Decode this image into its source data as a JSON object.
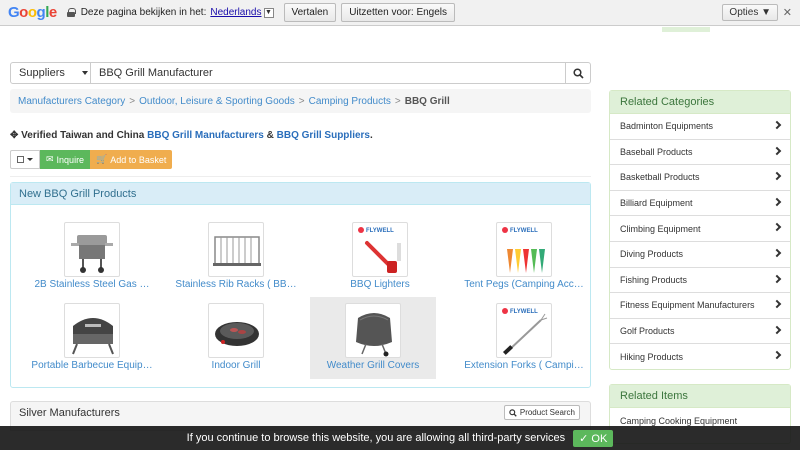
{
  "translate_bar": {
    "message": "Deze pagina bekijken in het:",
    "language": "Nederlands",
    "translate_label": "Vertalen",
    "disable_label": "Uitzetten voor: Engels",
    "options_label": "Opties ▼",
    "close_glyph": "✕"
  },
  "search": {
    "category": "Suppliers",
    "query": "BBQ Grill Manufacturer"
  },
  "breadcrumb": {
    "items": [
      "Manufacturers Category",
      "Outdoor, Leisure & Sporting Goods",
      "Camping Products"
    ],
    "separator": ">",
    "current": "BBQ Grill"
  },
  "verified": {
    "prefix": "Verified Taiwan and China",
    "link1": "BBQ Grill Manufacturers",
    "amp": "&",
    "link2": "BBQ Grill Suppliers",
    "suffix": "."
  },
  "actions": {
    "inquire_label": "Inquire",
    "basket_label": "Add to Basket"
  },
  "products_panel": {
    "title": "New BBQ Grill Products",
    "items": [
      {
        "label": "2B Stainless Steel Gas …",
        "icon": "gas-grill-image"
      },
      {
        "label": "Stainless Rib Racks ( BB…",
        "icon": "rib-rack-image"
      },
      {
        "label": "BBQ Lighters",
        "icon": "lighter-image"
      },
      {
        "label": "Tent Pegs (Camping Acc…",
        "icon": "tent-pegs-image"
      },
      {
        "label": "Portable Barbecue Equip…",
        "icon": "portable-barbecue-image"
      },
      {
        "label": "Indoor Grill",
        "icon": "indoor-grill-image"
      },
      {
        "label": "Weather Grill Covers",
        "icon": "grill-cover-image"
      },
      {
        "label": "Extension Forks ( Campi…",
        "icon": "extension-fork-image"
      }
    ],
    "brand_text": "FLYWELL"
  },
  "silver_panel": {
    "title": "Silver Manufacturers",
    "button_label": "Product Search"
  },
  "related_categories": {
    "title": "Related Categories",
    "items": [
      "Badminton Equipments",
      "Baseball Products",
      "Basketball Products",
      "Billiard Equipment",
      "Climbing Equipment",
      "Diving Products",
      "Fishing Products",
      "Fitness Equipment Manufacturers",
      "Golf Products",
      "Hiking Products"
    ]
  },
  "related_items": {
    "title": "Related Items",
    "items": [
      "Camping Cooking Equipment"
    ]
  },
  "cookie": {
    "message": "If you continue to browse this website, you are allowing all third-party services",
    "ok_label": "✓ OK"
  },
  "colors": {
    "link": "#428bca",
    "success": "#5cb85c",
    "warning": "#f0ad4e",
    "info_bg": "#d9edf7",
    "green_bg": "#dff0d8"
  }
}
